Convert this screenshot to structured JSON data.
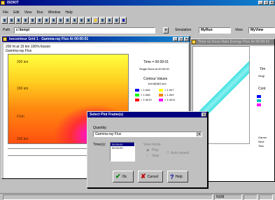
{
  "app": {
    "title": "ISOKIT"
  },
  "menu": [
    "File",
    "Edit",
    "View",
    "Run",
    "Window",
    "Help"
  ],
  "path_bar": {
    "path_label": "Path",
    "path_value": "c:\\temp\\",
    "simulation_label": "Simulation",
    "simulation_value": "MyRun",
    "view_label": "View",
    "view_value": "MyView"
  },
  "left_window": {
    "title": "Isocontour Grid 1 - Gamma-ray Flux At 00:00:01",
    "plot_title_1": "200 ht at 15 km 100% fission",
    "plot_title_2": "Gamma-ray Flux",
    "time_label": "Time = 00:00:01",
    "single_burst": "Single Burst at 00:00:00",
    "contour_title": "Contour Values",
    "contour_units": "1/cm@@2-sec",
    "legend": [
      {
        "label": "> 1.0e6",
        "color": "#0000ff"
      },
      {
        "label": "> 1.0e7",
        "color": "#ffff00"
      },
      {
        "label": "> 1.0e8",
        "color": "#00ff00"
      },
      {
        "label": "> 1.0e9",
        "color": "#ff8000"
      },
      {
        "label": "> 1.0e10",
        "color": "#ff0000"
      },
      {
        "label": "> 1.0e11",
        "color": "#ff00ff"
      }
    ],
    "axis_labels": [
      "200 km",
      "100 km",
      "0 km",
      "100 km"
    ]
  },
  "right_window": {
    "title": "Time vs Dose Rate Energy Flux At 00:00:01",
    "labels": [
      "Tim",
      "Singl",
      "Cont",
      "Gamm",
      "Neut",
      "Tota"
    ]
  },
  "dialog": {
    "title": "Select Plot Frame(s)",
    "quantity_label": "Quantity:",
    "quantity_value": "Gamma-ray Flux",
    "times_label": "Time(s):",
    "times": [
      "00:00:01",
      "00:00:00"
    ],
    "view_mode_label": "View mode",
    "radio_play": "Play",
    "radio_step": "Step",
    "auto_repeat": "Auto repeat",
    "ok": "Ok",
    "cancel": "Cancel",
    "help": "Help"
  },
  "status": {
    "num": "NUM"
  }
}
